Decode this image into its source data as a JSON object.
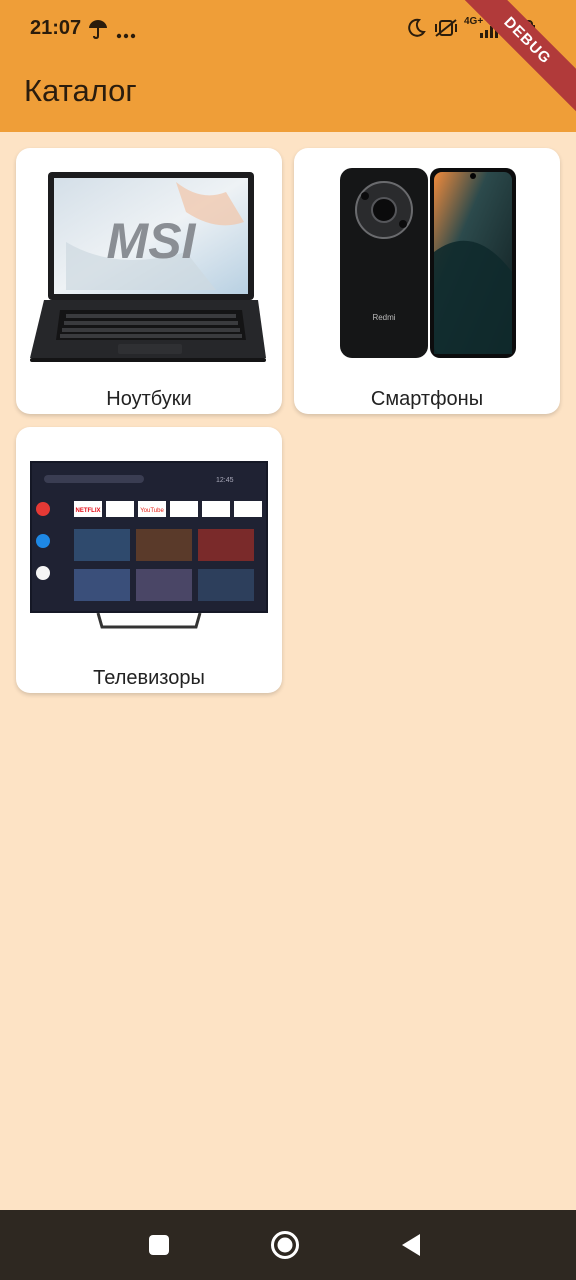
{
  "status_bar": {
    "time": "21:07",
    "icons": [
      "umbrella-icon",
      "more-dots-icon",
      "moon-icon",
      "muted-vibrate-icon",
      "signal-4g-icon",
      "battery-icon"
    ],
    "network_label": "4G+"
  },
  "appbar": {
    "title": "Каталог",
    "background": "#ef9e38"
  },
  "debug_banner": "DEBUG",
  "catalog": {
    "items": [
      {
        "label": "Ноутбуки",
        "image": "laptop-image"
      },
      {
        "label": "Смартфоны",
        "image": "smartphone-image"
      },
      {
        "label": "Телевизоры",
        "image": "tv-image"
      }
    ]
  },
  "laptop_logo": "MSI",
  "phone_brand": "Redmi",
  "tv_apps": [
    "NETFLIX",
    "YouTube"
  ],
  "tv_clock": "12:45",
  "nav_bar": {
    "buttons": [
      "recents-button",
      "home-button",
      "back-button"
    ]
  },
  "colors": {
    "page_background": "#fde3c5",
    "appbar": "#ef9e38",
    "navbar": "#2e2821"
  }
}
